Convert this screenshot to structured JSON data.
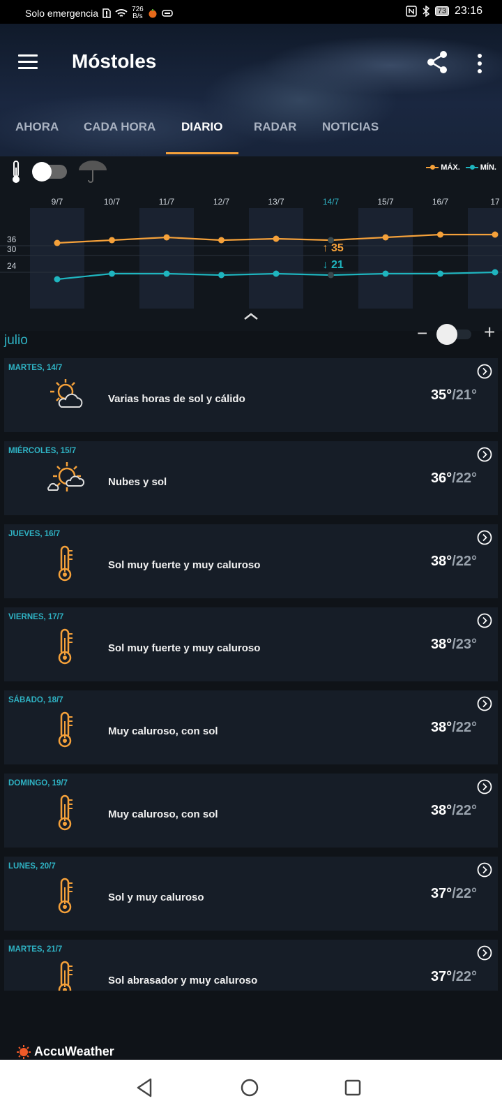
{
  "status_bar": {
    "carrier": "Solo emergencia",
    "net_speed_value": "726",
    "net_speed_unit": "B/s",
    "battery": "73",
    "time": "23:16"
  },
  "header": {
    "city": "Móstoles",
    "tabs": [
      {
        "label": "AHORA"
      },
      {
        "label": "CADA HORA"
      },
      {
        "label": "DIARIO"
      },
      {
        "label": "RADAR"
      },
      {
        "label": "NOTICIAS"
      }
    ],
    "active_tab": "DIARIO"
  },
  "graph": {
    "legend_max": "MÁX.",
    "legend_min": "MÍN.",
    "max_color": "#f5a13a",
    "min_color": "#1fb5bf",
    "dates": [
      "9/7",
      "10/7",
      "11/7",
      "12/7",
      "13/7",
      "14/7",
      "15/7",
      "16/7",
      "17"
    ],
    "selected_date": "14/7",
    "y_ticks": [
      "36",
      "30",
      "24"
    ],
    "selected_max": "35",
    "selected_min": "21",
    "max_values": [
      33,
      34,
      35,
      34,
      34.5,
      34,
      35,
      36,
      36
    ],
    "min_values": [
      20,
      22,
      22,
      21.5,
      22,
      21.5,
      22,
      22,
      22.5
    ]
  },
  "month": "julio",
  "days": [
    {
      "date": "MARTES, 14/7",
      "desc": "Varias horas de sol y cálido",
      "hi": "35°",
      "lo": "/21°",
      "icon": "partly-sunny-icon"
    },
    {
      "date": "MIÉRCOLES, 15/7",
      "desc": "Nubes y sol",
      "hi": "36°",
      "lo": "/22°",
      "icon": "sun-clouds-icon"
    },
    {
      "date": "JUEVES, 16/7",
      "desc": "Sol muy fuerte y muy caluroso",
      "hi": "38°",
      "lo": "/22°",
      "icon": "thermometer-icon"
    },
    {
      "date": "VIERNES, 17/7",
      "desc": "Sol muy fuerte y muy caluroso",
      "hi": "38°",
      "lo": "/23°",
      "icon": "thermometer-icon"
    },
    {
      "date": "SÁBADO, 18/7",
      "desc": "Muy caluroso, con sol",
      "hi": "38°",
      "lo": "/22°",
      "icon": "thermometer-icon"
    },
    {
      "date": "DOMINGO, 19/7",
      "desc": "Muy caluroso, con sol",
      "hi": "38°",
      "lo": "/22°",
      "icon": "thermometer-icon"
    },
    {
      "date": "LUNES, 20/7",
      "desc": "Sol y muy caluroso",
      "hi": "37°",
      "lo": "/22°",
      "icon": "thermometer-icon"
    },
    {
      "date": "MARTES, 21/7",
      "desc": "Sol abrasador y muy caluroso",
      "hi": "37°",
      "lo": "/22°",
      "icon": "thermometer-icon"
    }
  ],
  "footer": {
    "brand": "AccuWeather"
  }
}
